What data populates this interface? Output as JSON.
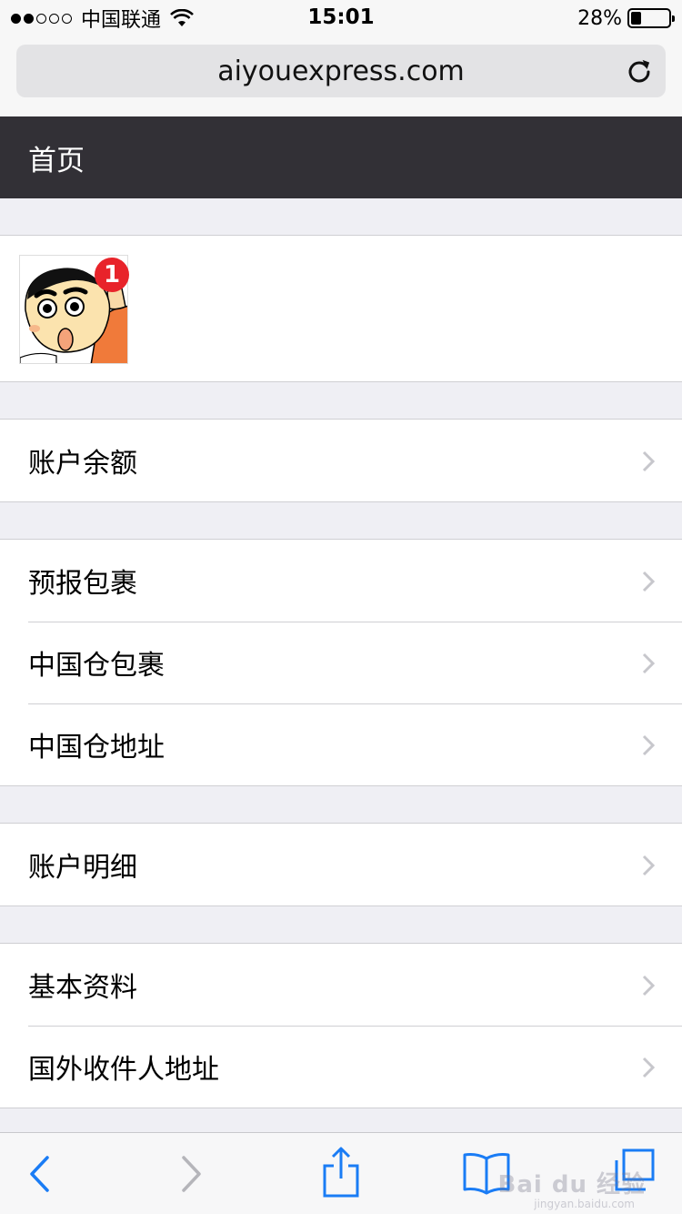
{
  "status_bar": {
    "signal_dots_filled": 2,
    "signal_dots_total": 5,
    "carrier": "中国联通",
    "time": "15:01",
    "battery_percent": "28%",
    "battery_level": 0.28
  },
  "browser": {
    "url": "aiyouexpress.com"
  },
  "header": {
    "title": "首页"
  },
  "profile": {
    "avatar_icon": "cartoon-avatar-icon",
    "badge_count": "1",
    "badge_color": "#e8232a"
  },
  "menu": {
    "account_balance": "账户余额",
    "prealert_package": "预报包裹",
    "china_warehouse_package": "中国仓包裹",
    "china_warehouse_address": "中国仓地址",
    "account_details": "账户明细",
    "basic_info": "基本资料",
    "overseas_recipient_address": "国外收件人地址"
  },
  "toolbar": {
    "accent_color": "#1a7cf5",
    "disabled_color": "#b5b5ba"
  },
  "watermark": {
    "text": "Bai du 经验",
    "subtext": "jingyan.baidu.com"
  }
}
